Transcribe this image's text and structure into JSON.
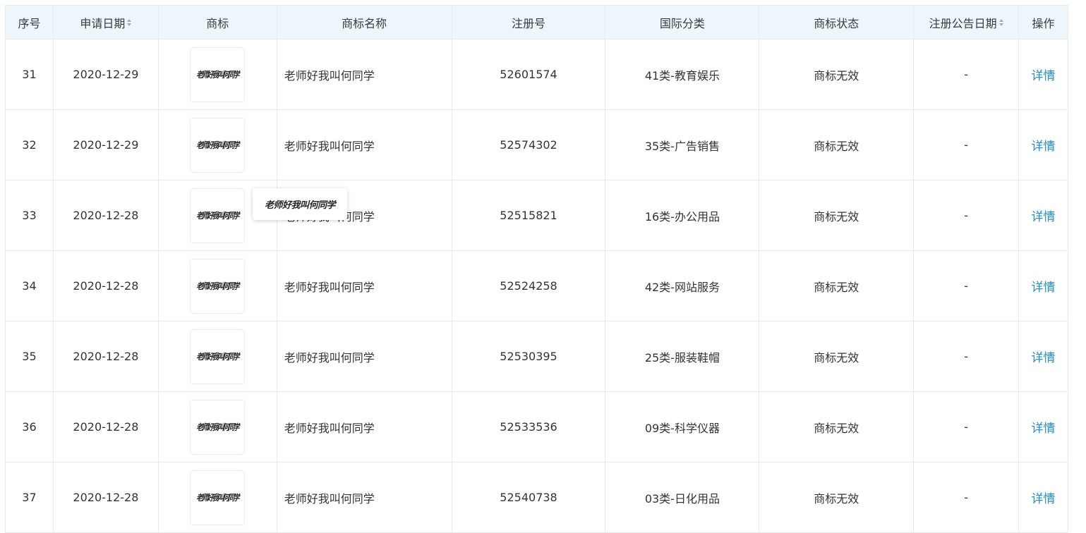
{
  "table": {
    "headers": {
      "index": "序号",
      "apply_date": "申请日期",
      "logo": "商标",
      "name": "商标名称",
      "reg_no": "注册号",
      "intl_class": "国际分类",
      "status": "商标状态",
      "pub_date": "注册公告日期",
      "action": "操作"
    },
    "rows": [
      {
        "index": "31",
        "apply_date": "2020-12-29",
        "logo_text": "老师好我叫何同学",
        "name": "老师好我叫何同学",
        "reg_no": "52601574",
        "intl_class": "41类-教育娱乐",
        "status": "商标无效",
        "pub_date": "-",
        "action": "详情"
      },
      {
        "index": "32",
        "apply_date": "2020-12-29",
        "logo_text": "老师好我叫何同学",
        "name": "老师好我叫何同学",
        "reg_no": "52574302",
        "intl_class": "35类-广告销售",
        "status": "商标无效",
        "pub_date": "-",
        "action": "详情"
      },
      {
        "index": "33",
        "apply_date": "2020-12-28",
        "logo_text": "老师好我叫何同学",
        "name": "老师好我叫何同学",
        "reg_no": "52515821",
        "intl_class": "16类-办公用品",
        "status": "商标无效",
        "pub_date": "-",
        "action": "详情"
      },
      {
        "index": "34",
        "apply_date": "2020-12-28",
        "logo_text": "老师好我叫何同学",
        "name": "老师好我叫何同学",
        "reg_no": "52524258",
        "intl_class": "42类-网站服务",
        "status": "商标无效",
        "pub_date": "-",
        "action": "详情"
      },
      {
        "index": "35",
        "apply_date": "2020-12-28",
        "logo_text": "老师好我叫何同学",
        "name": "老师好我叫何同学",
        "reg_no": "52530395",
        "intl_class": "25类-服装鞋帽",
        "status": "商标无效",
        "pub_date": "-",
        "action": "详情"
      },
      {
        "index": "36",
        "apply_date": "2020-12-28",
        "logo_text": "老师好我叫何同学",
        "name": "老师好我叫何同学",
        "reg_no": "52533536",
        "intl_class": "09类-科学仪器",
        "status": "商标无效",
        "pub_date": "-",
        "action": "详情"
      },
      {
        "index": "37",
        "apply_date": "2020-12-28",
        "logo_text": "老师好我叫何同学",
        "name": "老师好我叫何同学",
        "reg_no": "52540738",
        "intl_class": "03类-日化用品",
        "status": "商标无效",
        "pub_date": "-",
        "action": "详情"
      }
    ]
  },
  "tooltip": {
    "text": "老师好我叫何同学"
  },
  "colors": {
    "header_bg": "#eef5fb",
    "border": "#e8eaec",
    "link": "#1f8fcf",
    "text": "#333333"
  },
  "icons": {
    "sort": "sort-caret-icon"
  }
}
